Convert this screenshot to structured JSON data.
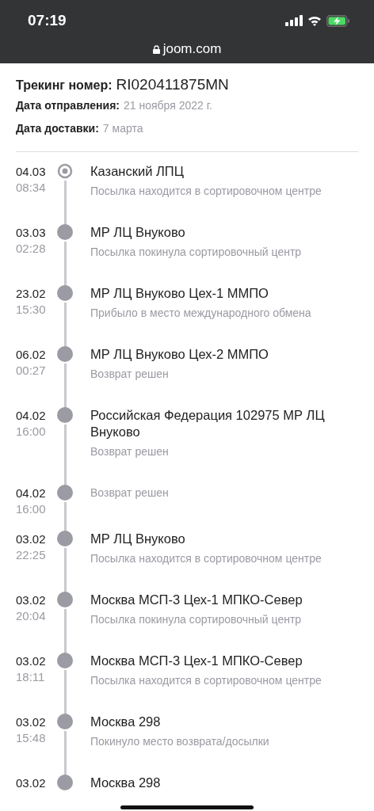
{
  "status_bar": {
    "time": "07:19"
  },
  "address_bar": {
    "url": "joom.com"
  },
  "header": {
    "tracking_label": "Трекинг номер:",
    "tracking_number": "RI020411875MN",
    "fields": [
      {
        "label": "Дата отправления:",
        "value": "21 ноября 2022 г."
      },
      {
        "label": "Дата доставки:",
        "value": "7 марта"
      }
    ]
  },
  "events": [
    {
      "date": "04.03",
      "time": "08:34",
      "title": "Казанский ЛПЦ",
      "status": "Посылка находится в сортировочном центре",
      "current": true
    },
    {
      "date": "03.03",
      "time": "02:28",
      "title": "МР ЛЦ Внуково",
      "status": "Посылка покинула сортировочный центр",
      "current": false
    },
    {
      "date": "23.02",
      "time": "15:30",
      "title": "МР ЛЦ Внуково Цех-1 ММПО",
      "status": "Прибыло в место международного обмена",
      "current": false
    },
    {
      "date": "06.02",
      "time": "00:27",
      "title": "МР ЛЦ Внуково Цех-2 ММПО",
      "status": "Возврат решен",
      "current": false
    },
    {
      "date": "04.02",
      "time": "16:00",
      "title": "Российская Федерация 102975 МР ЛЦ Внуково",
      "status": "Возврат решен",
      "current": false
    },
    {
      "date": "04.02",
      "time": "16:00",
      "status": "Возврат решен",
      "current": false
    },
    {
      "date": "03.02",
      "time": "22:25",
      "title": "МР ЛЦ Внуково",
      "status": "Посылка находится в сортировочном центре",
      "current": false
    },
    {
      "date": "03.02",
      "time": "20:04",
      "title": "Москва МСП-3 Цех-1 МПКО-Север",
      "status": "Посылка покинула сортировочный центр",
      "current": false
    },
    {
      "date": "03.02",
      "time": "18:11",
      "title": "Москва МСП-3 Цех-1 МПКО-Север",
      "status": "Посылка находится в сортировочном центре",
      "current": false
    },
    {
      "date": "03.02",
      "time": "15:48",
      "title": "Москва 298",
      "status": "Покинуло место возврата/досылки",
      "current": false
    },
    {
      "date": "03.02",
      "title": "Москва 298",
      "current": false
    }
  ]
}
